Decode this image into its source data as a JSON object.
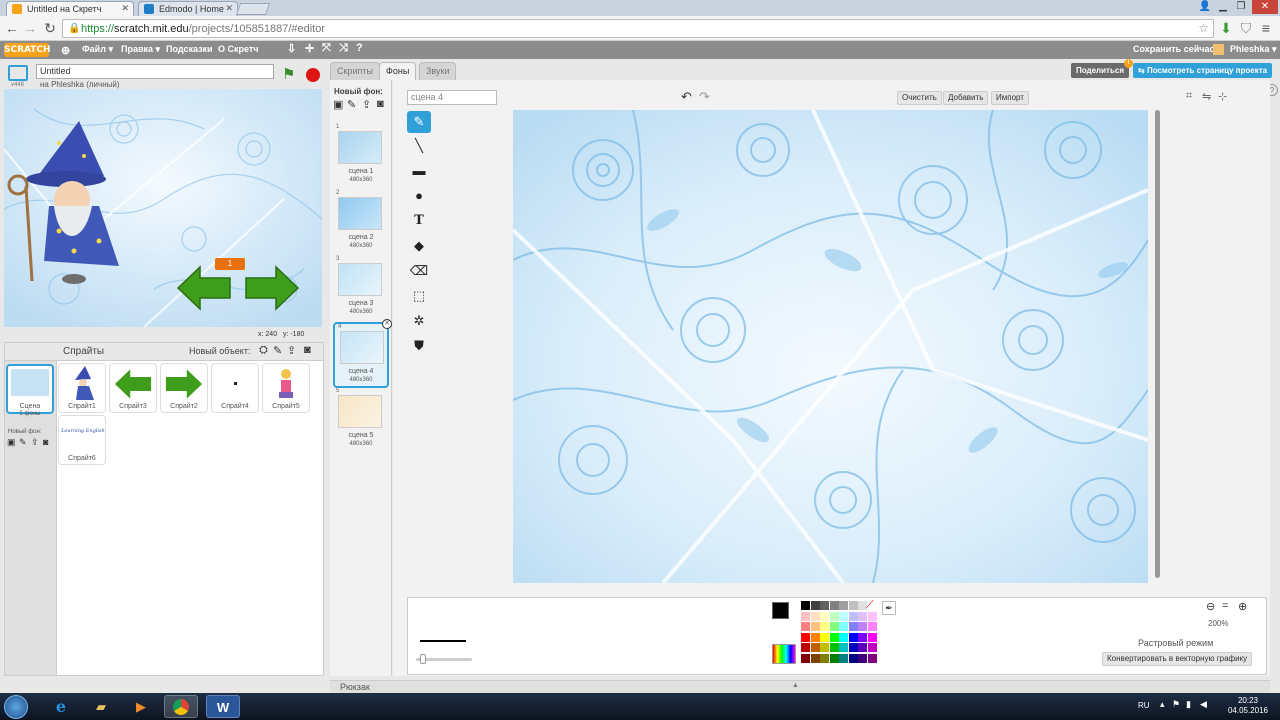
{
  "browser": {
    "tabs": [
      {
        "title": "Untitled на Скретч",
        "active": true
      },
      {
        "title": "Edmodo | Home",
        "active": false
      }
    ],
    "url_https": "https://",
    "url_host": "scratch.mit.edu",
    "url_path": "/projects/105851887/#editor"
  },
  "menu": {
    "logo": "SCRATCH",
    "file": "Файл ▾",
    "edit": "Правка ▾",
    "tips": "Подсказки",
    "about": "О Скретч",
    "save_now": "Сохранить сейчас",
    "user": "Phleshka ▾"
  },
  "project": {
    "title": "Untitled",
    "owner": "на Phleshka (личный)",
    "version": "v448"
  },
  "stage": {
    "counter": "1",
    "x_label": "x:",
    "x_value": "240",
    "y_label": "y:",
    "y_value": "-180"
  },
  "sprites_pane": {
    "title": "Спрайты",
    "new_object": "Новый объект:",
    "scene_label": "Сцена",
    "scene_sub": "5 фоны",
    "new_backdrop": "Новый фон:",
    "sprites": [
      {
        "name": "Спрайт1"
      },
      {
        "name": "Спрайт3"
      },
      {
        "name": "Спрайт2"
      },
      {
        "name": "Спрайт4"
      },
      {
        "name": "Спрайт5"
      },
      {
        "name": "Спрайт6",
        "image_text": "Learning English"
      }
    ]
  },
  "editor_tabs": {
    "scripts": "Скрипты",
    "backdrops": "Фоны",
    "sounds": "Звуки"
  },
  "share": {
    "share_label": "Поделиться",
    "badge": "!",
    "see_page": "Посмотреть страницу проекта"
  },
  "costumes": {
    "new_backdrop": "Новый фон:",
    "items": [
      {
        "num": "1",
        "name": "сцена 1",
        "size": "480x360"
      },
      {
        "num": "2",
        "name": "сцена 2",
        "size": "480x360"
      },
      {
        "num": "3",
        "name": "сцена 3",
        "size": "480x360"
      },
      {
        "num": "4",
        "name": "сцена 4",
        "size": "480x360",
        "selected": true
      },
      {
        "num": "5",
        "name": "сцена 5",
        "size": "480x360"
      }
    ]
  },
  "editor": {
    "costume_name": "сцена 4",
    "clear": "Очистить",
    "add": "Добавить",
    "import": "Импорт",
    "zoom": "200%",
    "mode": "Растровый режим",
    "convert": "Конвертировать в векторную графику"
  },
  "backpack": {
    "label": "Рюкзак"
  },
  "taskbar": {
    "lang": "RU",
    "time": "20:23",
    "date": "04.05.2016"
  },
  "colors": {
    "accent": "#30a0d8",
    "menubar": "#8c8c8c",
    "share": "#6b6b6b",
    "scratch_orange": "#f7a21b"
  }
}
